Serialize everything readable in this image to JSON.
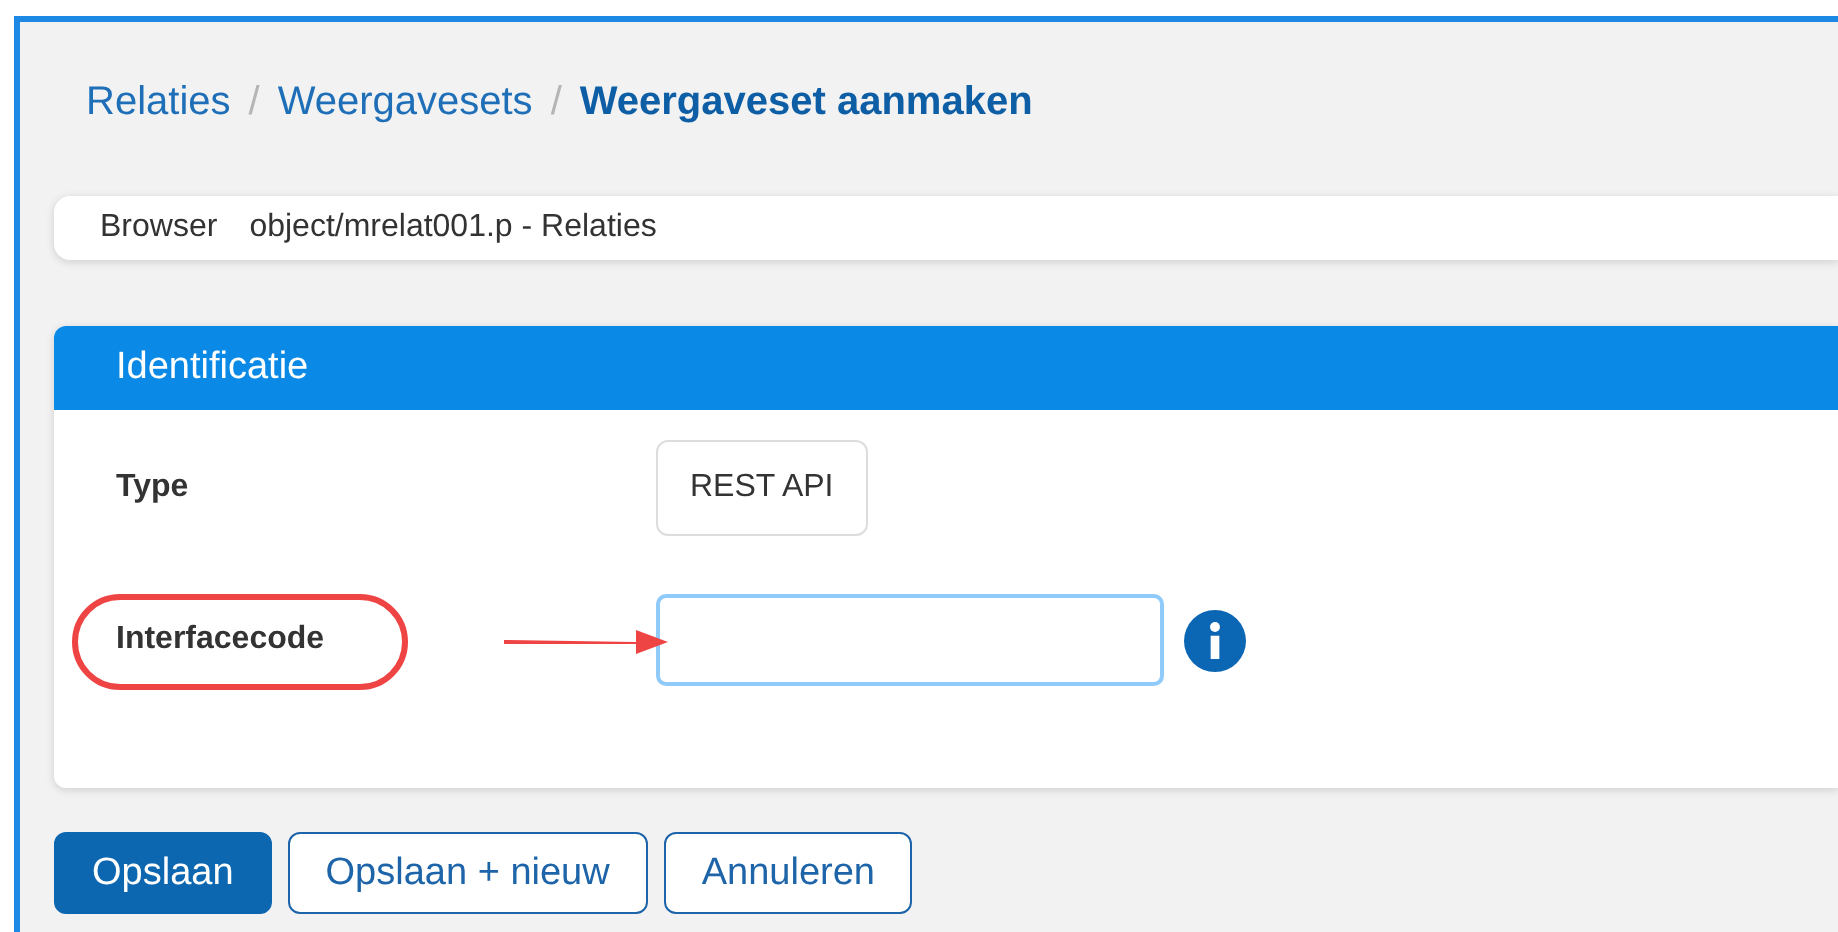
{
  "breadcrumb": [
    {
      "label": "Relaties",
      "current": false
    },
    {
      "label": "Weergavesets",
      "current": false
    },
    {
      "label": "Weergaveset aanmaken",
      "current": true
    }
  ],
  "separator": "/",
  "info_bar": {
    "label": "Browser",
    "value": "object/mrelat001.p - Relaties"
  },
  "panel": {
    "title": "Identificatie",
    "rows": [
      {
        "label": "Type",
        "kind": "static",
        "value": "REST API",
        "highlighted": false,
        "info": false
      },
      {
        "label": "Interfacecode",
        "kind": "input",
        "value": "",
        "highlighted": true,
        "info": true
      }
    ]
  },
  "buttons": [
    {
      "label": "Opslaan",
      "kind": "primary"
    },
    {
      "label": "Opslaan + nieuw",
      "kind": "secondary"
    },
    {
      "label": "Annuleren",
      "kind": "secondary"
    }
  ]
}
